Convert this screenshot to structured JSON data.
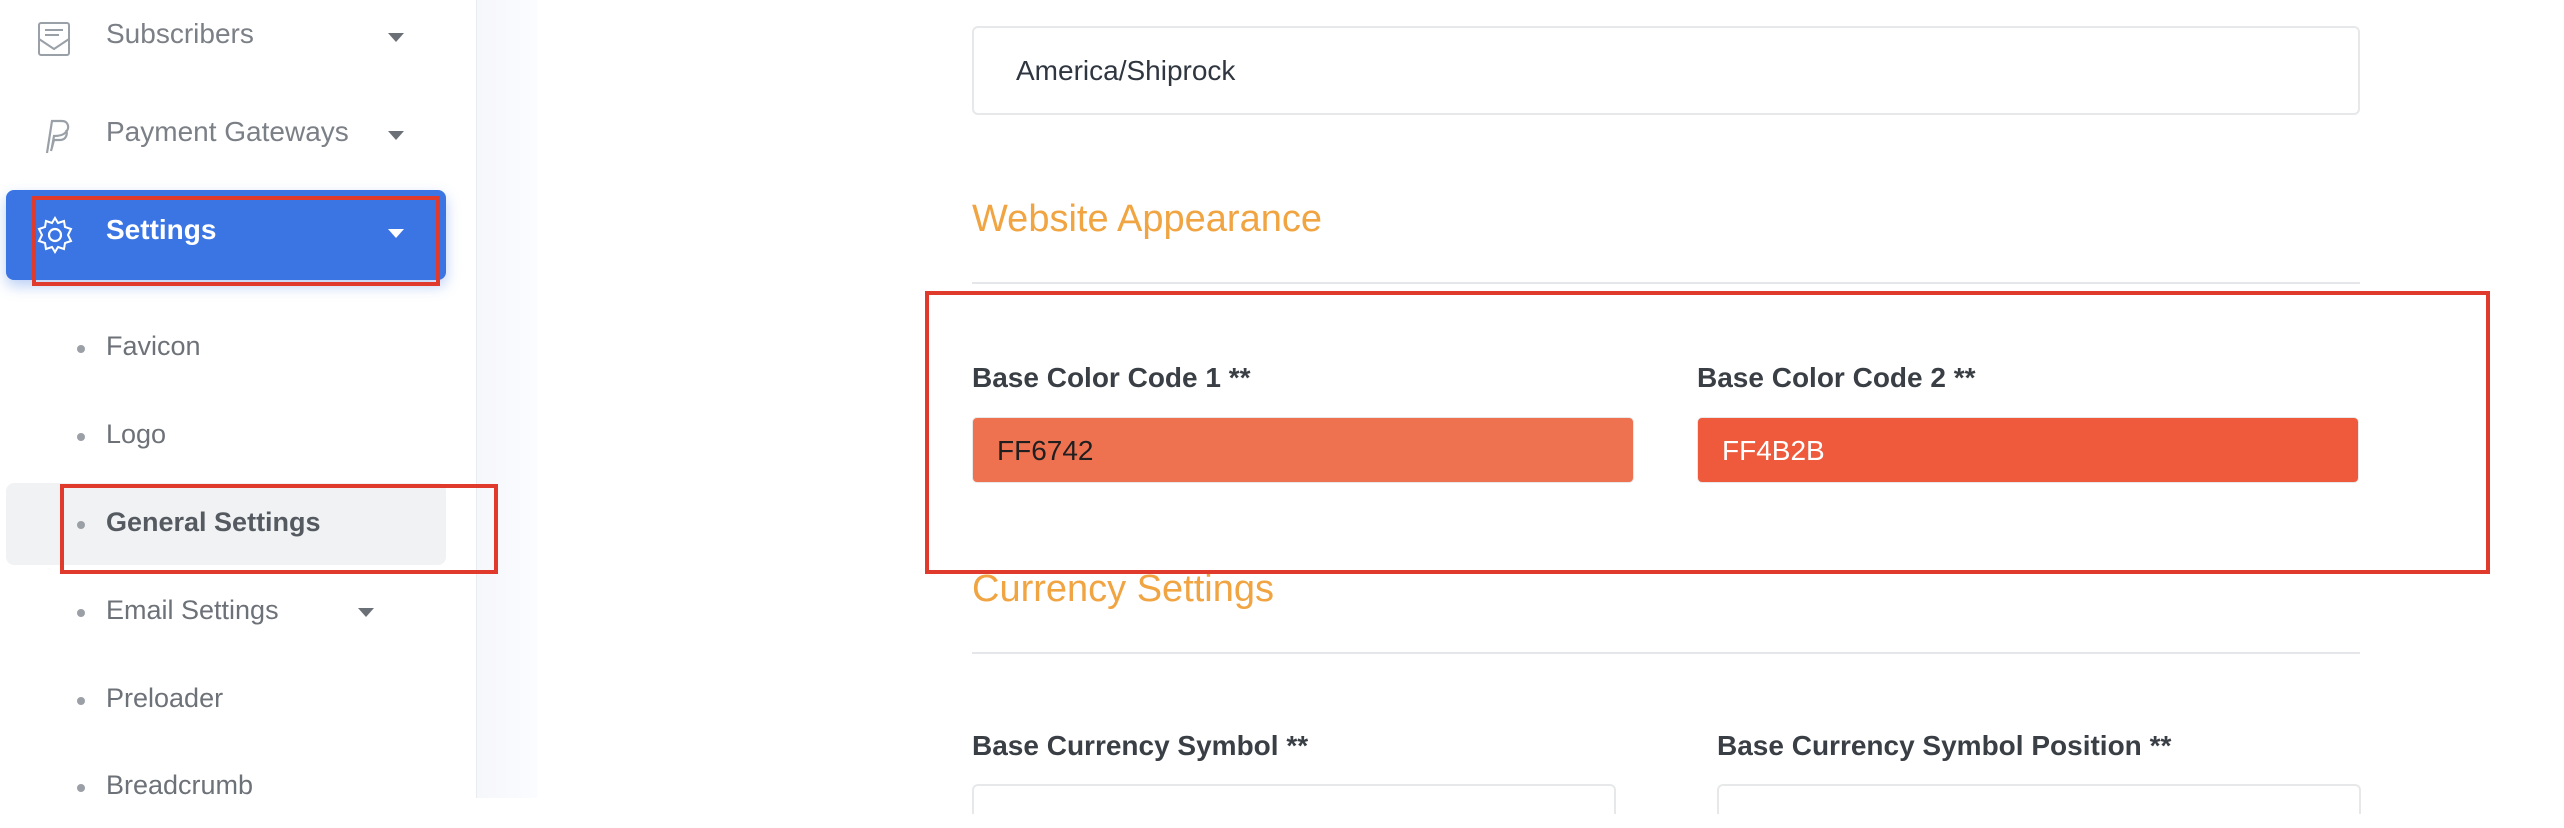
{
  "sidebar": {
    "items": [
      {
        "label": "Subscribers",
        "icon": "subscribers-icon"
      },
      {
        "label": "Payment Gateways",
        "icon": "paypal-icon"
      },
      {
        "label": "Settings",
        "icon": "gear-icon"
      }
    ],
    "settings_sub": [
      {
        "label": "Favicon"
      },
      {
        "label": "Logo"
      },
      {
        "label": "General Settings"
      },
      {
        "label": "Email Settings"
      },
      {
        "label": "Preloader"
      },
      {
        "label": "Breadcrumb"
      }
    ]
  },
  "main": {
    "timezone_value": "America/Shiprock",
    "appearance_title": "Website Appearance",
    "base_color_1_label": "Base Color Code 1 **",
    "base_color_1_value": "FF6742",
    "base_color_1_hex": "#EE7150",
    "base_color_2_label": "Base Color Code 2 **",
    "base_color_2_value": "FF4B2B",
    "base_color_2_hex": "#EE5A3B",
    "currency_title": "Currency Settings",
    "currency_symbol_label": "Base Currency Symbol **",
    "currency_position_label": "Base Currency Symbol Position **"
  },
  "colors": {
    "accent": "#3A75E3",
    "section_title": "#F0A442",
    "annotation": "#E03A2C"
  }
}
